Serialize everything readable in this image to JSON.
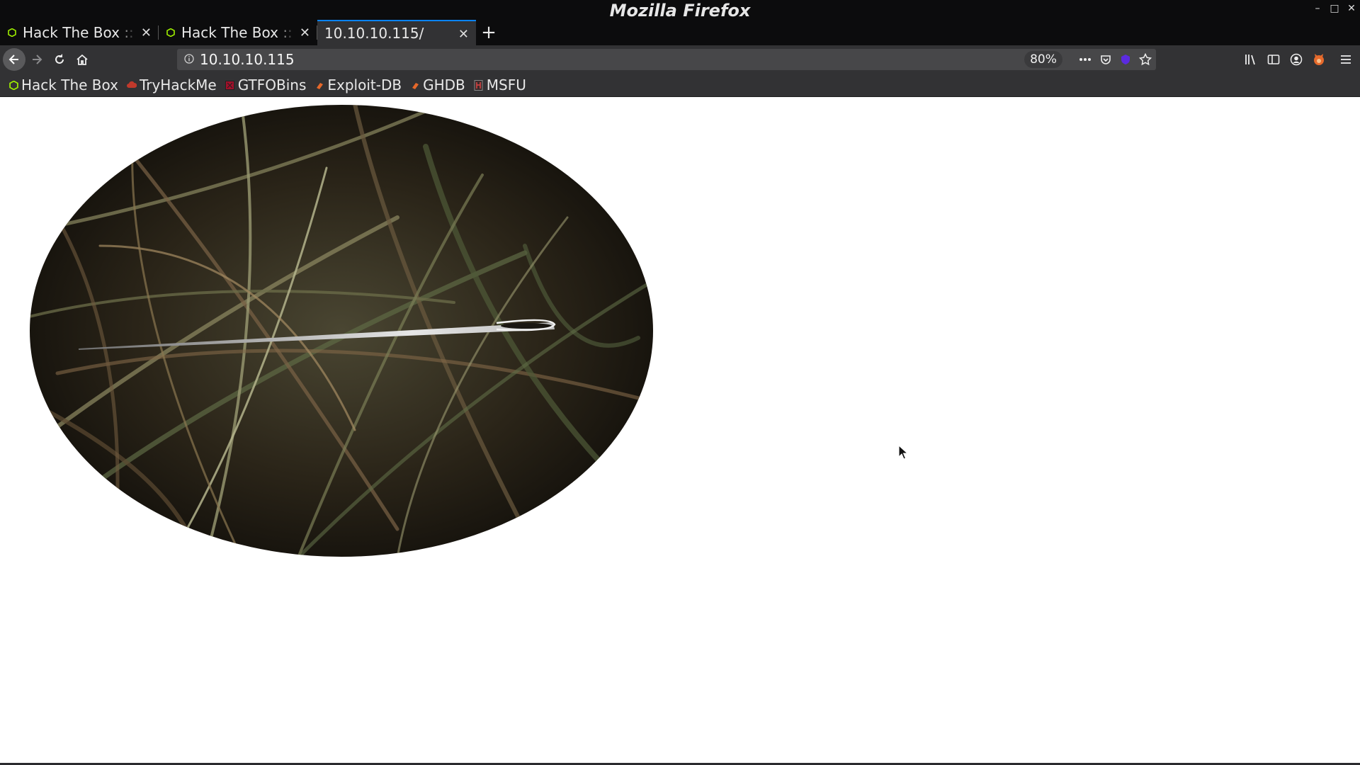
{
  "window": {
    "title": "Mozilla Firefox"
  },
  "tabs": [
    {
      "label": "Hack The Box :: M",
      "active": false
    },
    {
      "label": "Hack The Box :: H",
      "active": false
    },
    {
      "label": "10.10.10.115/",
      "active": true
    }
  ],
  "nav": {
    "url": "10.10.10.115",
    "zoom": "80%"
  },
  "bookmarks": [
    {
      "label": "Hack The Box",
      "icon": "htb-icon"
    },
    {
      "label": "TryHackMe",
      "icon": "tryhackme-icon"
    },
    {
      "label": "GTFOBins",
      "icon": "gtfobins-icon"
    },
    {
      "label": "Exploit-DB",
      "icon": "exploitdb-icon"
    },
    {
      "label": "GHDB",
      "icon": "ghdb-icon"
    },
    {
      "label": "MSFU",
      "icon": "msfu-icon"
    }
  ],
  "content": {
    "image": "needle-in-haystack"
  },
  "colors": {
    "chrome": "#0c0c0d",
    "toolbar": "#323234",
    "accent": "#0a84ff",
    "htb_green": "#9fef00"
  }
}
